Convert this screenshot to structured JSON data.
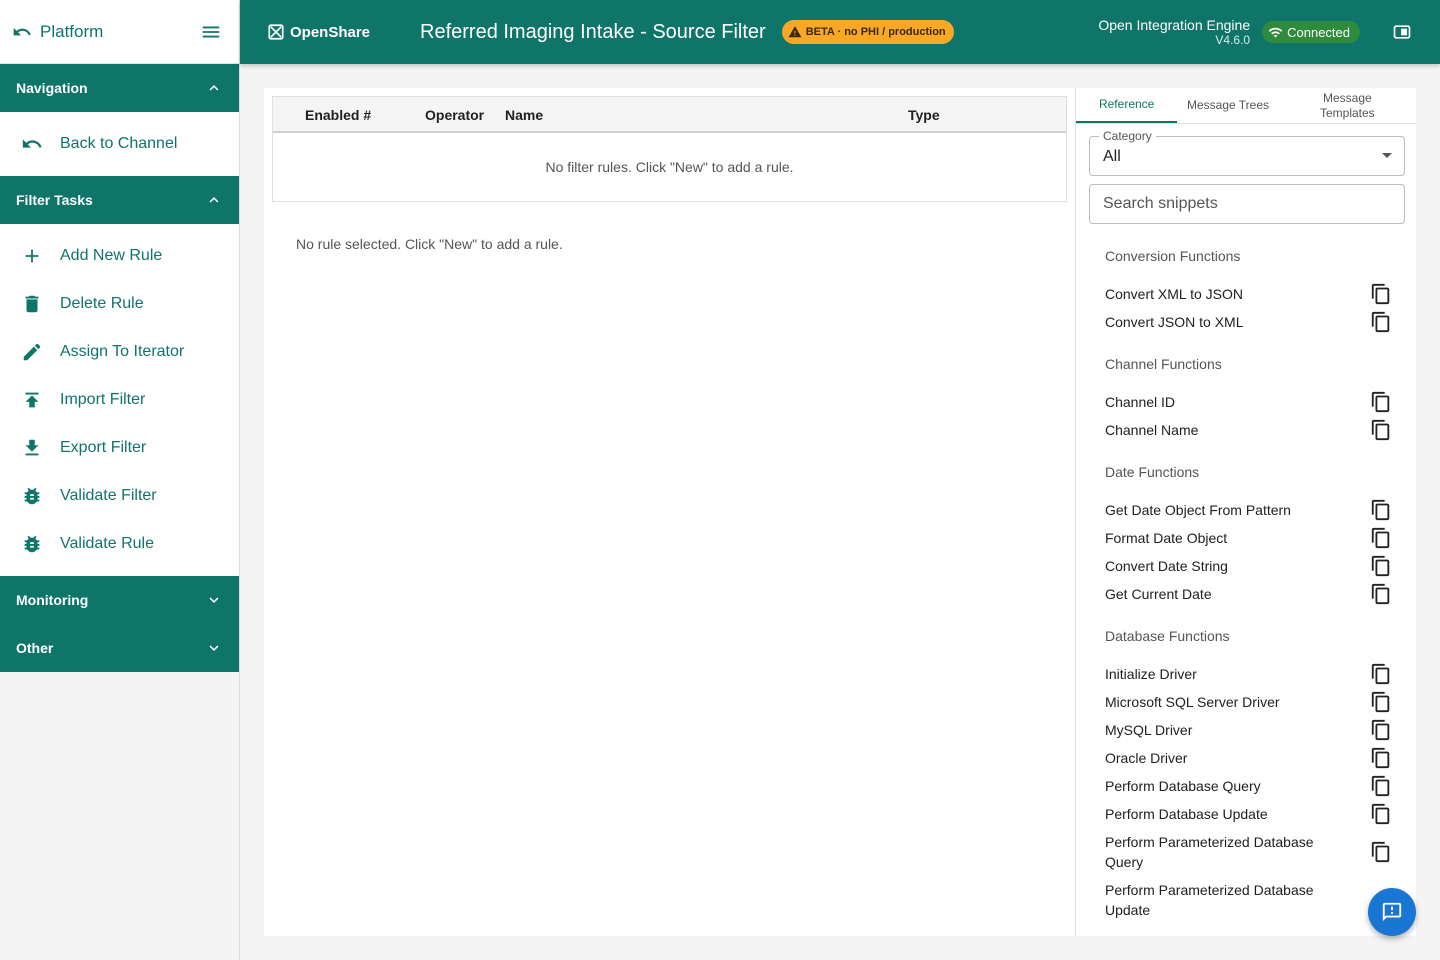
{
  "sidebar": {
    "platform_label": "Platform",
    "sections": [
      {
        "title": "Navigation",
        "expanded": true,
        "items": [
          {
            "label": "Back to Channel",
            "icon": "undo-icon"
          }
        ]
      },
      {
        "title": "Filter Tasks",
        "expanded": true,
        "items": [
          {
            "label": "Add New Rule",
            "icon": "plus-icon"
          },
          {
            "label": "Delete Rule",
            "icon": "trash-icon"
          },
          {
            "label": "Assign To Iterator",
            "icon": "pencil-icon"
          },
          {
            "label": "Import Filter",
            "icon": "upload-icon"
          },
          {
            "label": "Export Filter",
            "icon": "download-icon"
          },
          {
            "label": "Validate Filter",
            "icon": "bug-icon"
          },
          {
            "label": "Validate Rule",
            "icon": "bug-icon"
          }
        ]
      },
      {
        "title": "Monitoring",
        "expanded": false,
        "items": []
      },
      {
        "title": "Other",
        "expanded": false,
        "items": []
      }
    ]
  },
  "header": {
    "brand": "OpenShare",
    "title": "Referred Imaging Intake - Source Filter",
    "beta_badge": "BETA · no PHI / production",
    "engine_name": "Open Integration Engine",
    "version": "V4.6.0",
    "status": "Connected"
  },
  "rules_table": {
    "columns": [
      "Enabled #",
      "Operator",
      "Name",
      "Type"
    ],
    "empty_message": "No filter rules. Click \"New\" to add a rule.",
    "no_selection_message": "No rule selected. Click \"New\" to add a rule."
  },
  "reference_panel": {
    "tabs": [
      {
        "label": "Reference",
        "active": true
      },
      {
        "label": "Message Trees",
        "active": false
      },
      {
        "label": "Message Templates",
        "active": false
      }
    ],
    "category_label": "Category",
    "category_value": "All",
    "search_placeholder": "Search snippets",
    "groups": [
      {
        "title": "Conversion Functions",
        "items": [
          "Convert XML to JSON",
          "Convert JSON to XML"
        ]
      },
      {
        "title": "Channel Functions",
        "items": [
          "Channel ID",
          "Channel Name"
        ]
      },
      {
        "title": "Date Functions",
        "items": [
          "Get Date Object From Pattern",
          "Format Date Object",
          "Convert Date String",
          "Get Current Date"
        ]
      },
      {
        "title": "Database Functions",
        "items": [
          "Initialize Driver",
          "Microsoft SQL Server Driver",
          "MySQL Driver",
          "Oracle Driver",
          "Perform Database Query",
          "Perform Database Update",
          "Perform Parameterized Database Query",
          "Perform Parameterized Database Update"
        ]
      }
    ]
  },
  "colors": {
    "primary": "#107569",
    "beta": "#f9a825",
    "connected": "#2e8b3c",
    "fab": "#1976d2"
  }
}
